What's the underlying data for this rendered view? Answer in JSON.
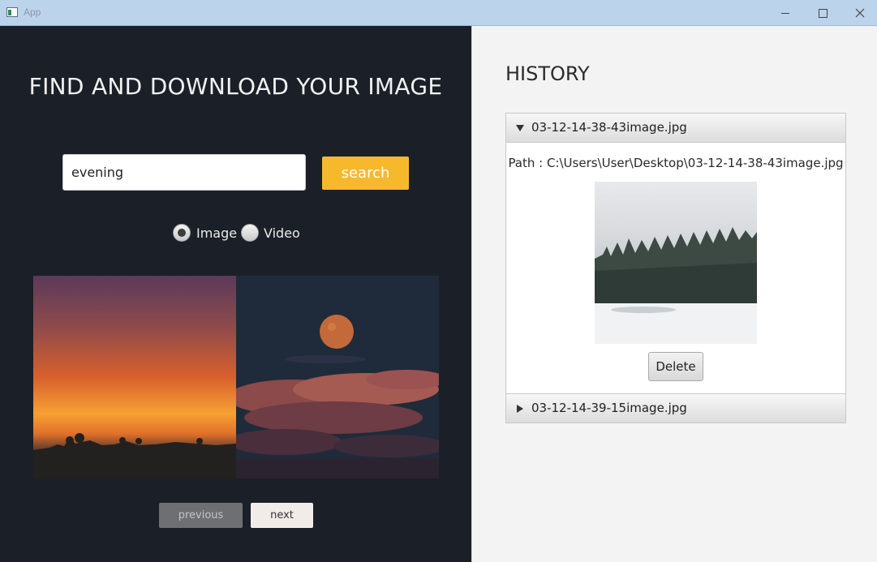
{
  "window": {
    "title": "App",
    "icons": {
      "app": "app-window-icon",
      "minimize": "minimize-icon",
      "maximize": "maximize-icon",
      "close": "close-icon"
    }
  },
  "search_panel": {
    "heading": "FIND AND DOWNLOAD YOUR IMAGE",
    "search_value": "evening",
    "search_button": "search",
    "media_types": [
      {
        "label": "Image",
        "selected": true
      },
      {
        "label": "Video",
        "selected": false
      }
    ],
    "results": [
      {
        "name": "sunset-image",
        "description": "sunset"
      },
      {
        "name": "moon-clouds-image",
        "description": "moon over clouds"
      }
    ],
    "previous_label": "previous",
    "next_label": "next"
  },
  "history": {
    "title": "HISTORY",
    "items": [
      {
        "filename": "03-12-14-38-43image.jpg",
        "expanded": true,
        "path": "Path : C:\\Users\\User\\Desktop\\03-12-14-38-43image.jpg",
        "delete_label": "Delete"
      },
      {
        "filename": "03-12-14-39-15image.jpg",
        "expanded": false
      }
    ]
  },
  "colors": {
    "left_background": "#1b1f27",
    "accent": "#f7b92c",
    "right_background": "#f3f3f3"
  }
}
